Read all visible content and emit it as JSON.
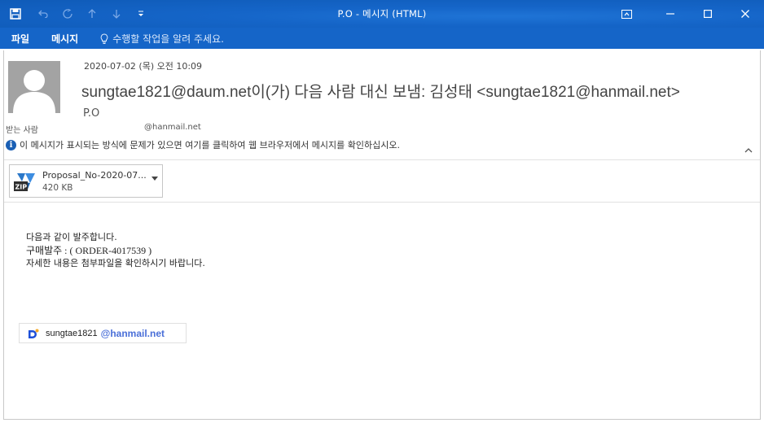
{
  "window": {
    "title": "P.O - 메시지 (HTML)"
  },
  "quick_access": {
    "icons": [
      "save-icon",
      "undo-icon",
      "redo-icon",
      "up-arrow-icon",
      "down-arrow-icon",
      "customize-dropdown-icon"
    ]
  },
  "menu": {
    "file": "파일",
    "message": "메시지",
    "tell_me": "수행할 작업을 알려 주세요."
  },
  "message": {
    "date": "2020-07-02 (목) 오전 10:09",
    "sender": "sungtae1821@daum.net이(가) 다음 사람 대신 보냄: 김성태 <sungtae1821@hanmail.net>",
    "subject": "P.O",
    "to_label": "받는 사람",
    "to_value": "@hanmail.net",
    "info_bar": "이 메시지가 표시되는 방식에 문제가 있으면 여기를 클릭하여 웹 브라우저에서 메시지를 확인하십시오."
  },
  "attachment": {
    "name": "Proposal_No-2020-07...",
    "size": "420 KB",
    "type_badge": "ZIP"
  },
  "body": {
    "line1": "다음과 같이 발주합니다.",
    "line2": "구매발주 : ( ORDER-4017539 )",
    "line3": "자세한 내용은 첨부파일을 확인하시기 바랍니다."
  },
  "signature": {
    "name": "sungtae1821",
    "domain": "@hanmail.net"
  },
  "colors": {
    "titlebar": "#1565c8",
    "link_blue": "#4a6fd8",
    "info_icon": "#1a5fb4"
  }
}
